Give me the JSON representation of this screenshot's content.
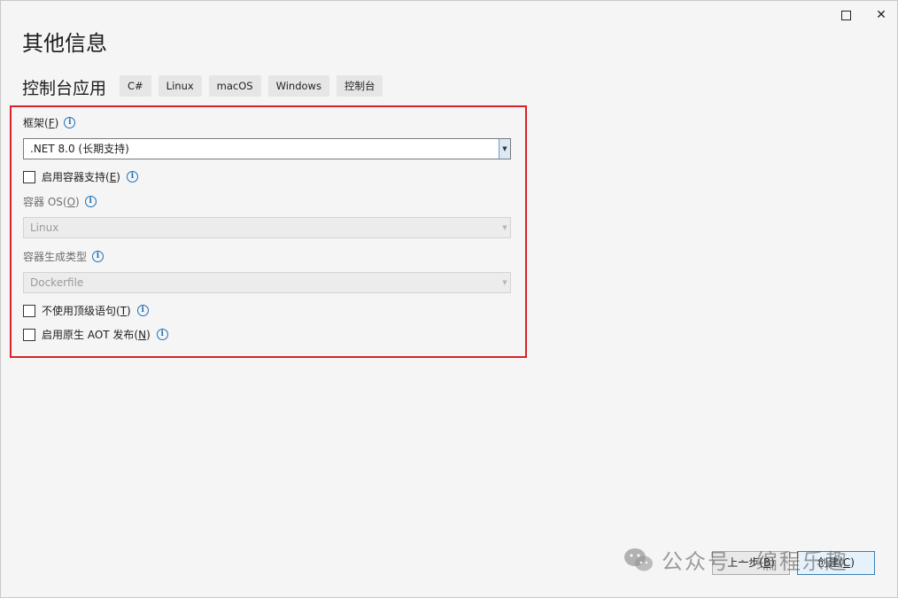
{
  "window": {
    "maximize_icon": "maximize-icon",
    "close_glyph": "✕"
  },
  "header": {
    "title": "其他信息",
    "template_name": "控制台应用",
    "tags": [
      "C#",
      "Linux",
      "macOS",
      "Windows",
      "控制台"
    ]
  },
  "form": {
    "framework": {
      "label": "框架",
      "accesskey": "F",
      "value": ".NET 8.0 (长期支持)"
    },
    "enable_container": {
      "label": "启用容器支持",
      "accesskey": "E",
      "checked": false
    },
    "container_os": {
      "label": "容器 OS",
      "accesskey": "O",
      "value": "Linux",
      "disabled": true
    },
    "container_build_type": {
      "label": "容器生成类型",
      "value": "Dockerfile",
      "disabled": true
    },
    "no_top_level_statements": {
      "label": "不使用顶级语句",
      "accesskey": "T",
      "checked": false
    },
    "enable_native_aot": {
      "label": "启用原生 AOT 发布",
      "accesskey": "N",
      "checked": false
    }
  },
  "footer": {
    "back_label": "上一步",
    "back_accesskey": "B",
    "create_label": "创建",
    "create_accesskey": "C"
  },
  "watermark": {
    "text": "公众号 · 编程乐趣"
  },
  "colors": {
    "highlight_border": "#d8232a",
    "info_icon": "#1f6fb6"
  }
}
